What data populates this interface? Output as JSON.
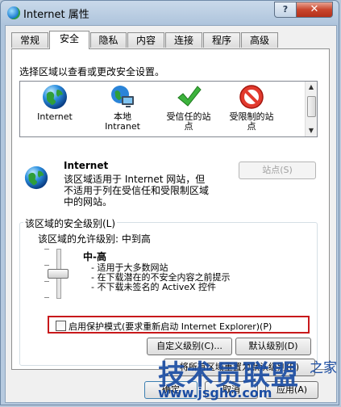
{
  "window": {
    "title": "Internet 属性",
    "help_label": "?",
    "close_label": "✕"
  },
  "tabs": [
    {
      "label": "常规"
    },
    {
      "label": "安全"
    },
    {
      "label": "隐私"
    },
    {
      "label": "内容"
    },
    {
      "label": "连接"
    },
    {
      "label": "程序"
    },
    {
      "label": "高级"
    }
  ],
  "security": {
    "instruction": "选择区域以查看或更改安全设置。",
    "zones": [
      {
        "label": "Internet",
        "icon": "globe-icon"
      },
      {
        "label": "本地\nIntranet",
        "icon": "intranet-icon"
      },
      {
        "label": "受信任的站\n点",
        "icon": "checkmark-icon"
      },
      {
        "label": "受限制的站\n点",
        "icon": "no-entry-icon"
      }
    ],
    "selected_zone": {
      "name": "Internet",
      "description": "该区域适用于 Internet 网站，但不适用于列在受信任和受限制区域中的网站。",
      "sites_button": "站点(S)"
    },
    "level_group": {
      "title": "该区域的安全级别(L)",
      "allowed_levels": "该区域的允许级别: 中到高",
      "level_name": "中-高",
      "bullets": [
        "- 适用于大多数网站",
        "- 在下载潜在的不安全内容之前提示",
        "- 不下载未签名的 ActiveX 控件"
      ],
      "protected_mode_label": "启用保护模式(要求重新启动 Internet Explorer)(P)",
      "protected_mode_checked": false,
      "custom_level_button": "自定义级别(C)...",
      "default_level_button": "默认级别(D)"
    },
    "reset_all_button": "将所有区域重置为默认级别(R)"
  },
  "dialog_buttons": {
    "ok": "确定",
    "cancel": "取消",
    "apply": "应用(A)"
  },
  "watermark": {
    "text": "技术员联盟",
    "url": "www.jsgho.com",
    "tail": "之家"
  },
  "colors": {
    "highlight_border": "#c8191b",
    "watermark": "#1b4da3",
    "titlebar": "#b7cadf"
  }
}
